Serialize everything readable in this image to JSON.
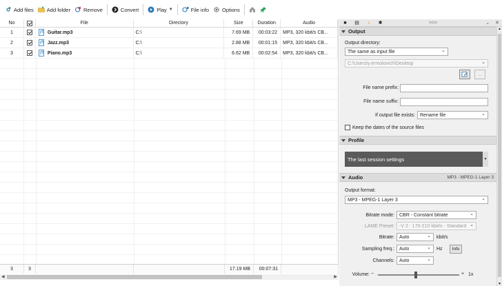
{
  "toolbar": {
    "add_files": "Add files",
    "add_folder": "Add folder",
    "remove": "Remove",
    "convert": "Convert",
    "play": "Play",
    "file_info": "File info",
    "options": "Options"
  },
  "grid": {
    "headers": {
      "no": "No",
      "file": "File",
      "directory": "Directory",
      "size": "Size",
      "duration": "Duration",
      "audio": "Audio"
    },
    "rows": [
      {
        "no": "1",
        "file": "Guitar.mp3",
        "directory": "C:\\",
        "size": "7.69 MB",
        "duration": "00:03:22",
        "audio": "MP3, 320 kbit/s CB..."
      },
      {
        "no": "2",
        "file": "Jazz.mp3",
        "directory": "C:\\",
        "size": "2.88 MB",
        "duration": "00:01:15",
        "audio": "MP3, 320 kbit/s CB..."
      },
      {
        "no": "3",
        "file": "Piano.mp3",
        "directory": "C:\\",
        "size": "6.62 MB",
        "duration": "00:02:54",
        "audio": "MP3, 320 kbit/s CB..."
      }
    ],
    "footer": {
      "count": "3",
      "checked": "3",
      "total_size": "17.19 MB",
      "total_duration": "00:07:31"
    }
  },
  "panel": {
    "nav_arrows": ">>>",
    "output": {
      "title": "Output",
      "dir_label": "Output directory:",
      "dir_value": "The same as input file",
      "path_value": "C:\\Users\\y.ermolovich\\Desktop",
      "prefix_label": "File name prefix:",
      "suffix_label": "File name suffix:",
      "exists_label": "If output file exists:",
      "exists_value": "Rename file",
      "keep_dates_label": "Keep the dates of the source files",
      "browse_ellipsis": "..."
    },
    "profile": {
      "title": "Profile",
      "value": "The last session settings"
    },
    "audio": {
      "title": "Audio",
      "format_summary": "MP3 - MPEG-1 Layer 3",
      "format_label": "Output format:",
      "format_value": "MP3 - MPEG-1 Layer 3",
      "bitrate_mode_label": "Bitrate mode:",
      "bitrate_mode_value": "CBR - Constant bitrate",
      "lame_label": "LAME Preset:",
      "lame_value": "-V 2 : 170-210 kbit/s - Standard",
      "bitrate_label": "Bitrate:",
      "bitrate_value": "Auto",
      "bitrate_unit": "kbit/s",
      "sampling_label": "Sampling freq.:",
      "sampling_value": "Auto",
      "sampling_unit": "Hz",
      "info_button": "Info",
      "channels_label": "Channels:",
      "channels_value": "Auto",
      "volume_label": "Volume:",
      "volume_minus": "−",
      "volume_plus": "+",
      "volume_value": "1x",
      "volume_level": 0.45
    }
  }
}
